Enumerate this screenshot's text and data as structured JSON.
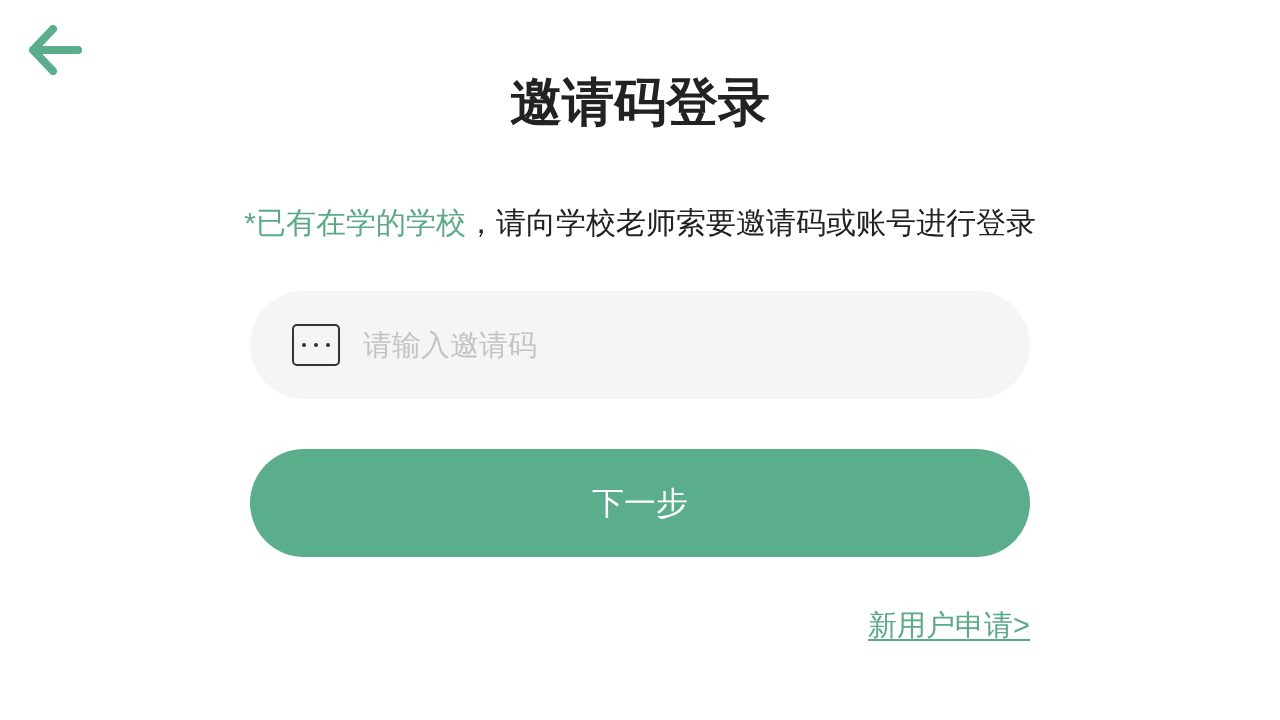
{
  "title": "邀请码登录",
  "notice": {
    "highlight": "*已有在学的学校",
    "text": "，请向学校老师索要邀请码或账号进行登录"
  },
  "invite_code_field": {
    "placeholder": "请输入邀请码"
  },
  "next_button": {
    "label": "下一步"
  },
  "new_user_link": {
    "label": "新用户申请>"
  }
}
